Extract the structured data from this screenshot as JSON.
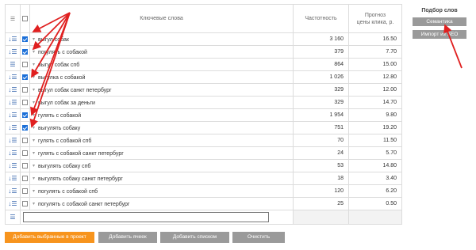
{
  "table": {
    "headers": {
      "keywords": "Ключевые слова",
      "frequency": "Частотность",
      "price_line1": "Прогноз",
      "price_line2": "цены клика, р."
    },
    "rows": [
      {
        "keyword": "выгул собак",
        "frequency": "3 160",
        "price": "16.50",
        "checked": true,
        "sorted": true
      },
      {
        "keyword": "погулять с собакой",
        "frequency": "379",
        "price": "7.70",
        "checked": true,
        "sorted": true
      },
      {
        "keyword": "выгул собак спб",
        "frequency": "864",
        "price": "15.00",
        "checked": false,
        "sorted": false
      },
      {
        "keyword": "выгулка с собакой",
        "frequency": "1 026",
        "price": "12.80",
        "checked": true,
        "sorted": true
      },
      {
        "keyword": "выгул собак санкт петербург",
        "frequency": "329",
        "price": "12.00",
        "checked": false,
        "sorted": true
      },
      {
        "keyword": "выгул собак за деньги",
        "frequency": "329",
        "price": "14.70",
        "checked": false,
        "sorted": true
      },
      {
        "keyword": "гулять с собакой",
        "frequency": "1 954",
        "price": "9.80",
        "checked": true,
        "sorted": true
      },
      {
        "keyword": "выгулять собаку",
        "frequency": "751",
        "price": "19.20",
        "checked": true,
        "sorted": true
      },
      {
        "keyword": "гулять с собакой спб",
        "frequency": "70",
        "price": "11.50",
        "checked": false,
        "sorted": true
      },
      {
        "keyword": "гулять с собакой санкт петербург",
        "frequency": "24",
        "price": "5.70",
        "checked": false,
        "sorted": true
      },
      {
        "keyword": "выгулять собаку спб",
        "frequency": "53",
        "price": "14.80",
        "checked": false,
        "sorted": true
      },
      {
        "keyword": "выгулять собаку санкт петербург",
        "frequency": "18",
        "price": "3.40",
        "checked": false,
        "sorted": true
      },
      {
        "keyword": "погулять с собакой спб",
        "frequency": "120",
        "price": "6.20",
        "checked": false,
        "sorted": true
      },
      {
        "keyword": "погулять с собакой санкт петербург",
        "frequency": "25",
        "price": "0.50",
        "checked": false,
        "sorted": true
      }
    ],
    "new_keyword_input": {
      "value": "",
      "placeholder": ""
    }
  },
  "sidebar": {
    "title": "Подбор слов",
    "buttons": [
      "Семантика",
      "Импорт из SEO"
    ]
  },
  "bottom": {
    "buttons": [
      "Добавить выбранные в проект",
      "Добавить ячеек",
      "Добавить списком",
      "Очистить"
    ]
  },
  "icons": {
    "row_sort": "sort-icon",
    "row_dropdown": "caret-down-icon",
    "header_list": "list-icon"
  },
  "colors": {
    "accent_orange": "#f7941d",
    "button_gray": "#9a9a9a",
    "checkbox_blue": "#1b6fd8",
    "annotation_arrow": "#e02020",
    "icon_blue": "#2a5da8"
  }
}
